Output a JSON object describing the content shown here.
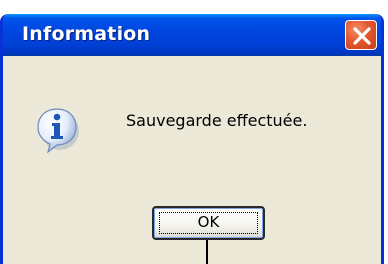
{
  "window": {
    "title": "Information",
    "close_icon": "close-icon"
  },
  "dialog": {
    "icon": "info-icon",
    "message": "Sauvegarde effectuée.",
    "ok_label": "OK"
  },
  "colors": {
    "titlebar": "#0046e0",
    "frame": "#0831d9",
    "body": "#ece9d8",
    "close_button": "#e4582d",
    "info_icon": "#1f56b8"
  }
}
